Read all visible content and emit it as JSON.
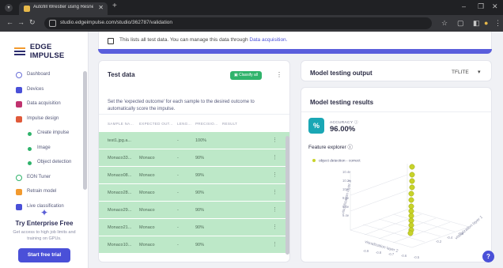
{
  "browser": {
    "tab_title": "Autofill Wrestler using Resnet",
    "url": "studio.edgeimpulse.com/studio/362787/validation"
  },
  "sidebar": {
    "brand": "EDGE IMPULSE",
    "items": [
      {
        "label": "Dashboard",
        "icon": "dashboard-icon",
        "sub": false
      },
      {
        "label": "Devices",
        "icon": "devices-icon",
        "sub": false
      },
      {
        "label": "Data acquisition",
        "icon": "data-acquisition-icon",
        "sub": false
      },
      {
        "label": "Impulse design",
        "icon": "impulse-design-icon",
        "sub": false
      },
      {
        "label": "Create impulse",
        "icon": "dot-icon",
        "sub": true
      },
      {
        "label": "Image",
        "icon": "dot-icon",
        "sub": true
      },
      {
        "label": "Object detection",
        "icon": "dot-icon",
        "sub": true
      },
      {
        "label": "EON Tuner",
        "icon": "eon-tuner-icon",
        "sub": false
      },
      {
        "label": "Retrain model",
        "icon": "retrain-icon",
        "sub": false
      },
      {
        "label": "Live classification",
        "icon": "live-icon",
        "sub": false
      }
    ],
    "trial": {
      "title": "Try Enterprise Free",
      "subtitle": "Get access to high job limits and training on GPUs.",
      "button": "Start free trial"
    }
  },
  "banner": {
    "text": "This lists all test data. You can manage this data through ",
    "link": "Data acquisition."
  },
  "test_data": {
    "title": "Test data",
    "classify_all": "Classify all",
    "description": "Set the 'expected outcome' for each sample to the desired outcome to automatically score the impulse.",
    "columns": [
      "SAMPLE NA...",
      "EXPECTED OUT...",
      "LENG...",
      "PRECISIO...",
      "RESULT"
    ],
    "rows": [
      {
        "name": "test1.jpg.a...",
        "expected": "",
        "length": "-",
        "precision": "100%",
        "result": ""
      },
      {
        "name": "Monaco33...",
        "expected": "Monaco",
        "length": "-",
        "precision": "90%",
        "result": ""
      },
      {
        "name": "Monaco08...",
        "expected": "Monaco",
        "length": "-",
        "precision": "99%",
        "result": ""
      },
      {
        "name": "Monaco28...",
        "expected": "Monaco",
        "length": "-",
        "precision": "90%",
        "result": ""
      },
      {
        "name": "Monaco29...",
        "expected": "Monaco",
        "length": "-",
        "precision": "90%",
        "result": ""
      },
      {
        "name": "Monaco21...",
        "expected": "Monaco",
        "length": "-",
        "precision": "90%",
        "result": ""
      },
      {
        "name": "Monaco10...",
        "expected": "Monaco",
        "length": "-",
        "precision": "90%",
        "result": ""
      }
    ]
  },
  "model_output": {
    "title": "Model testing output",
    "selector": "TFLITE"
  },
  "results": {
    "title": "Model testing results",
    "accuracy_label": "ACCURACY",
    "accuracy_value": "96.00%",
    "feature_explorer": "Feature explorer",
    "legend": "object detection - correct",
    "z_axis_label": "visualization layer 3",
    "x_axis_label": "visualization layer 2",
    "y_axis_label": "visualization layer 1",
    "z_ticks": [
      "10.4e",
      "10.2e",
      "10e",
      "9.8e",
      "9.6e",
      "9.4e"
    ],
    "x_ticks": [
      "-0.9",
      "-0.8",
      "-0.7",
      "-0.6",
      "-0.5"
    ],
    "y_ticks": [
      "-0.2",
      "-0.4",
      "-0.6"
    ]
  },
  "colors": {
    "accent": "#4a50d8",
    "success": "#2fb36b",
    "row_bg": "#bde8c8",
    "point": "#c8d32a"
  }
}
